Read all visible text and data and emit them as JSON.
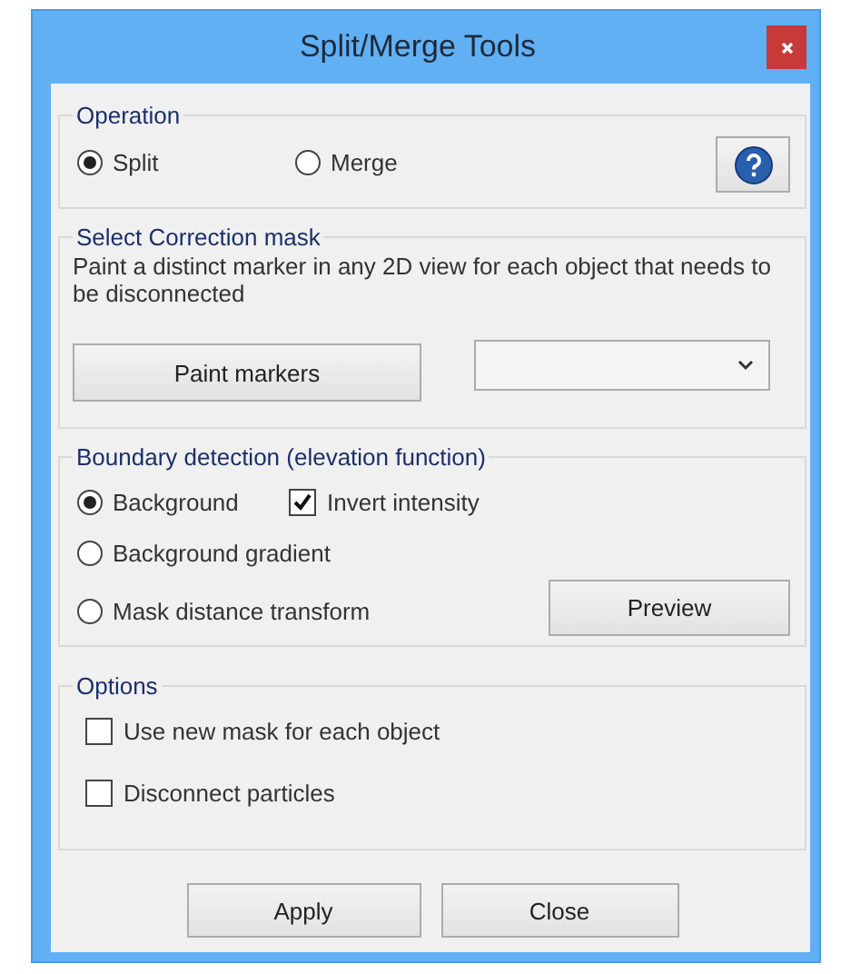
{
  "window": {
    "title": "Split/Merge Tools"
  },
  "operation": {
    "title": "Operation",
    "options": [
      {
        "label": "Split",
        "selected": true
      },
      {
        "label": "Merge",
        "selected": false
      }
    ]
  },
  "correction_mask": {
    "title": "Select Correction mask",
    "description": "Paint a distinct marker in any 2D view for each object that needs to be disconnected",
    "paint_button": "Paint markers"
  },
  "boundary_detection": {
    "title": "Boundary detection (elevation function)",
    "options": [
      {
        "label": "Background",
        "selected": true
      },
      {
        "label": "Background gradient",
        "selected": false
      },
      {
        "label": "Mask distance transform",
        "selected": false
      }
    ],
    "invert_intensity": {
      "label": "Invert intensity",
      "checked": true
    },
    "preview_button": "Preview"
  },
  "options": {
    "title": "Options",
    "items": [
      {
        "label": "Use new mask for each object",
        "checked": false
      },
      {
        "label": "Disconnect particles",
        "checked": false
      }
    ]
  },
  "buttons": [
    "Apply",
    "Close"
  ]
}
